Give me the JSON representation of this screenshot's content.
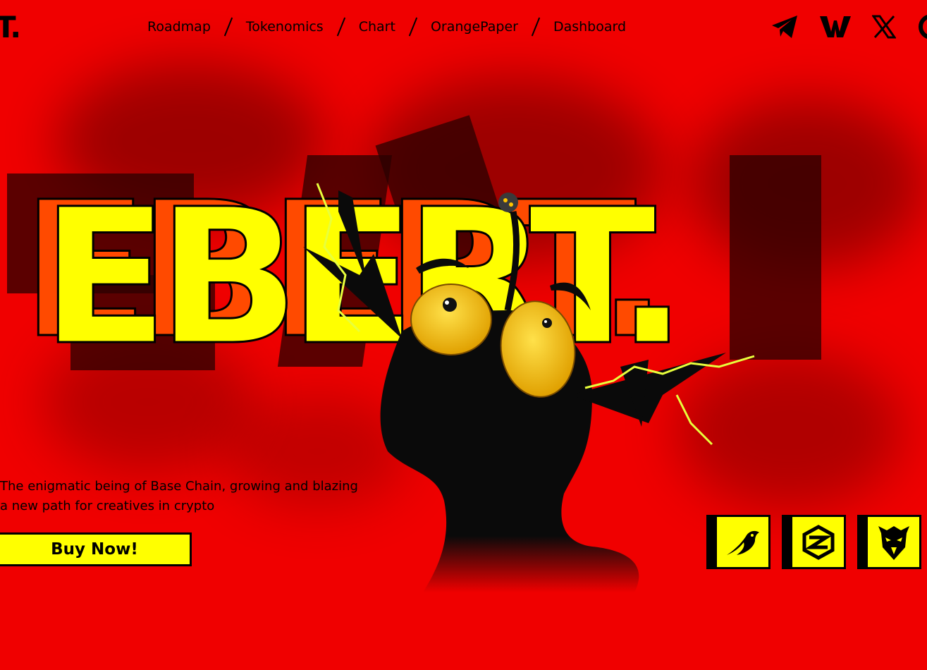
{
  "brand": {
    "logo_text": "T."
  },
  "nav": {
    "items": [
      {
        "label": "Roadmap"
      },
      {
        "label": "Tokenomics"
      },
      {
        "label": "Chart"
      },
      {
        "label": "OrangePaper"
      },
      {
        "label": "Dashboard"
      }
    ]
  },
  "socials": [
    {
      "icon": "telegram-icon"
    },
    {
      "icon": "warpcast-icon"
    },
    {
      "icon": "x-icon"
    },
    {
      "icon": "partial-circle-icon"
    }
  ],
  "hero": {
    "title": "EBERT.",
    "tagline_line1": "The enigmatic being of Base Chain, growing and blazing",
    "tagline_line2": "a new path for creatives in crypto",
    "cta_label": "Buy Now!"
  },
  "partners": [
    {
      "icon": "bird-logo-icon"
    },
    {
      "icon": "hexagon-logo-icon"
    },
    {
      "icon": "eagle-logo-icon"
    }
  ],
  "colors": {
    "background": "#f00000",
    "accent_yellow": "#ffff00",
    "accent_orange": "#ff4a00",
    "ink": "#000000"
  }
}
